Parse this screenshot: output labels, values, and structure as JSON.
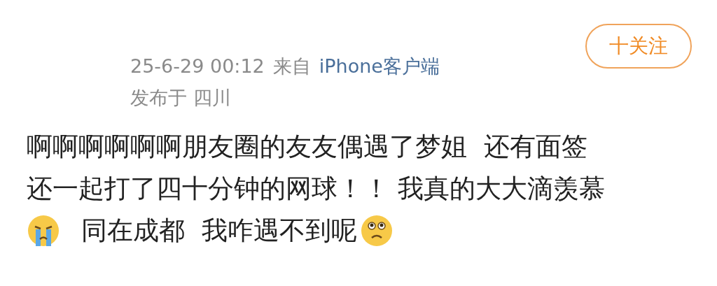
{
  "follow_button": {
    "label": "十关注"
  },
  "meta": {
    "time": "25-6-29 00:12",
    "source_prefix": "来自",
    "source_link": "iPhone客户端",
    "location": "发布于 四川"
  },
  "post": {
    "lines": [
      [
        {
          "kind": "text",
          "text": "啊啊啊啊啊啊朋友圈的友友偶遇了梦姐  还有面签"
        }
      ],
      [
        {
          "kind": "text",
          "text": "还一起打了四十分钟的网球！！ 我真的大大滴羡慕"
        }
      ],
      [
        {
          "kind": "crying-emoji"
        },
        {
          "kind": "text",
          "text": "同在成都  我咋遇不到呢"
        },
        {
          "kind": "pleading-emoji"
        }
      ]
    ]
  }
}
